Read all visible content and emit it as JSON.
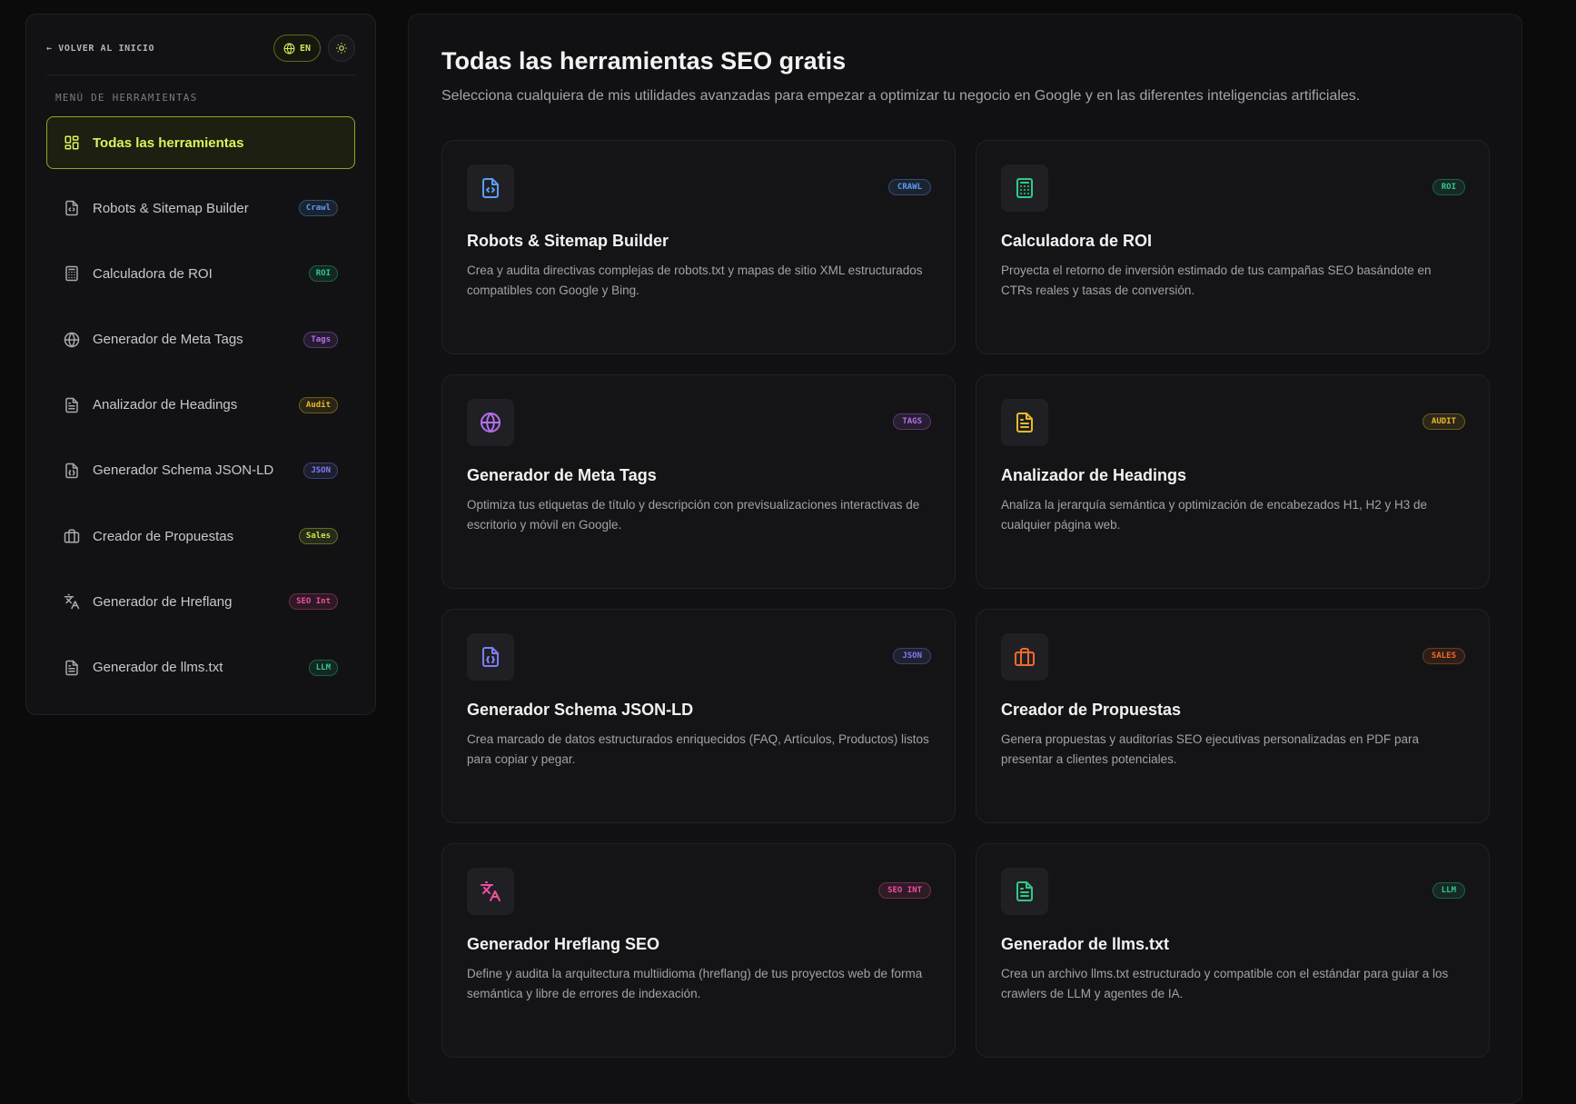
{
  "sidebar": {
    "back_label": "← VOLVER AL INICIO",
    "lang_label": "EN",
    "menu_title": "MENÚ DE HERRAMIENTAS",
    "items": [
      {
        "label": "Todas las herramientas",
        "badge": "",
        "icon": "grid-icon",
        "color": "#dff15c"
      },
      {
        "label": "Robots & Sitemap Builder",
        "badge": "Crawl",
        "icon": "file-code-icon",
        "color": "#5b9df5"
      },
      {
        "label": "Calculadora de ROI",
        "badge": "ROI",
        "icon": "calculator-icon",
        "color": "#2fc98a"
      },
      {
        "label": "Generador de Meta Tags",
        "badge": "Tags",
        "icon": "globe-icon",
        "color": "#b56ef0"
      },
      {
        "label": "Analizador de Headings",
        "badge": "Audit",
        "icon": "file-text-icon",
        "color": "#e8b928"
      },
      {
        "label": "Generador Schema JSON-LD",
        "badge": "JSON",
        "icon": "file-json-icon",
        "color": "#7b7ff5"
      },
      {
        "label": "Creador de Propuestas",
        "badge": "Sales",
        "icon": "briefcase-icon",
        "color": "#c9e34a"
      },
      {
        "label": "Generador de Hreflang",
        "badge": "SEO Int",
        "icon": "languages-icon",
        "color": "#ee4fa0"
      },
      {
        "label": "Generador de llms.txt",
        "badge": "LLM",
        "icon": "file-text-icon",
        "color": "#2fc98a"
      }
    ]
  },
  "main": {
    "title": "Todas las herramientas SEO gratis",
    "subtitle": "Selecciona cualquiera de mis utilidades avanzadas para empezar a optimizar tu negocio en Google y en las diferentes inteligencias artificiales.",
    "cards": [
      {
        "title": "Robots & Sitemap Builder",
        "badge": "CRAWL",
        "icon": "file-code-icon",
        "color": "#5b9df5",
        "desc": "Crea y audita directivas complejas de robots.txt y mapas de sitio XML estructurados compatibles con Google y Bing."
      },
      {
        "title": "Calculadora de ROI",
        "badge": "ROI",
        "icon": "calculator-icon",
        "color": "#2fc98a",
        "desc": "Proyecta el retorno de inversión estimado de tus campañas SEO basándote en CTRs reales y tasas de conversión."
      },
      {
        "title": "Generador de Meta Tags",
        "badge": "TAGS",
        "icon": "globe-icon",
        "color": "#b56ef0",
        "desc": "Optimiza tus etiquetas de título y descripción con previsualizaciones interactivas de escritorio y móvil en Google."
      },
      {
        "title": "Analizador de Headings",
        "badge": "AUDIT",
        "icon": "file-text-icon",
        "color": "#e8b928",
        "desc": "Analiza la jerarquía semántica y optimización de encabezados H1, H2 y H3 de cualquier página web."
      },
      {
        "title": "Generador Schema JSON-LD",
        "badge": "JSON",
        "icon": "file-json-icon",
        "color": "#7b7ff5",
        "desc": "Crea marcado de datos estructurados enriquecidos (FAQ, Artículos, Productos) listos para copiar y pegar."
      },
      {
        "title": "Creador de Propuestas",
        "badge": "SALES",
        "icon": "briefcase-icon",
        "color": "#f06a2a",
        "desc": "Genera propuestas y auditorías SEO ejecutivas personalizadas en PDF para presentar a clientes potenciales."
      },
      {
        "title": "Generador Hreflang SEO",
        "badge": "SEO INT",
        "icon": "languages-icon",
        "color": "#ee4fa0",
        "desc": "Define y audita la arquitectura multiidioma (hreflang) de tus proyectos web de forma semántica y libre de errores de indexación."
      },
      {
        "title": "Generador de llms.txt",
        "badge": "LLM",
        "icon": "file-text-icon",
        "color": "#2fc98a",
        "desc": "Crea un archivo llms.txt estructurado y compatible con el estándar para guiar a los crawlers de LLM y agentes de IA."
      }
    ]
  }
}
